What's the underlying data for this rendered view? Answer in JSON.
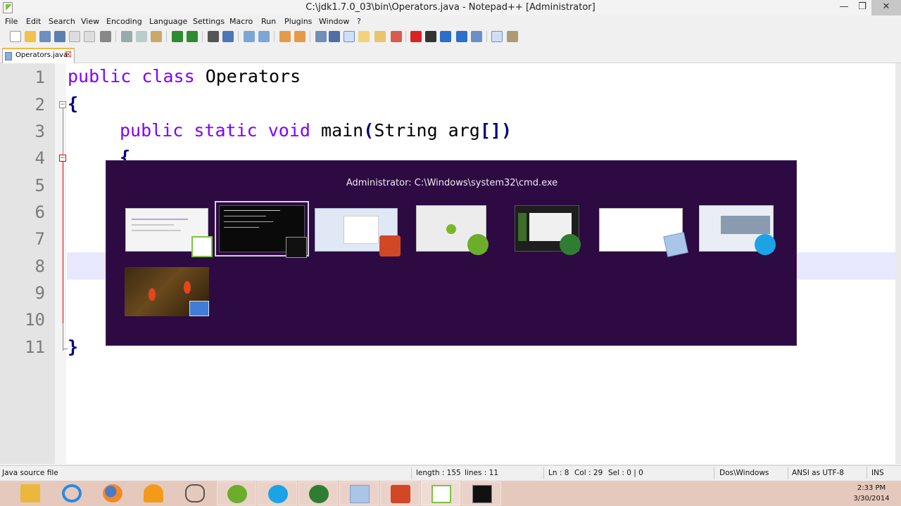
{
  "window": {
    "title": "C:\\jdk1.7.0_03\\bin\\Operators.java - Notepad++ [Administrator]",
    "minimize_glyph": "—",
    "restore_glyph": "❐",
    "close_glyph": "✕"
  },
  "menu": {
    "items": [
      "File",
      "Edit",
      "Search",
      "View",
      "Encoding",
      "Language",
      "Settings",
      "Macro",
      "Run",
      "Plugins",
      "Window",
      "?"
    ]
  },
  "tabs": [
    {
      "label": "Operators.java",
      "close_glyph": "☒"
    }
  ],
  "editor": {
    "line_numbers": [
      "1",
      "2",
      "3",
      "4",
      "5",
      "6",
      "7",
      "8",
      "9",
      "10",
      "11"
    ],
    "lines": {
      "l1_kw1": "public",
      "l1_kw2": "class",
      "l1_name": "Operators",
      "l2_brace": "{",
      "l3_kw1": "public",
      "l3_kw2": "static",
      "l3_kw3": "void",
      "l3_method": "main",
      "l3_open": "(",
      "l3_args": "String arg",
      "l3_brackets": "[]",
      "l3_close": ")",
      "l4_brace": "{",
      "l11_brace": "}"
    },
    "current_line": 8,
    "fold_markers": [
      "−",
      "−"
    ]
  },
  "task_switcher": {
    "title": "Administrator: C:\\Windows\\system32\\cmd.exe",
    "selected_index": 1,
    "windows": [
      {
        "icon": "notepadpp-icon"
      },
      {
        "icon": "cmd-icon"
      },
      {
        "icon": "powerpoint-icon"
      },
      {
        "icon": "utorrent-icon"
      },
      {
        "icon": "ccleaner-icon"
      },
      {
        "icon": "notepad-icon"
      },
      {
        "icon": "skype-icon"
      },
      {
        "icon": "photo-viewer-icon"
      }
    ]
  },
  "status": {
    "file_type": "Java source file",
    "length": "length : 155",
    "lines": "lines : 11",
    "ln": "Ln : 8",
    "col": "Col : 29",
    "sel": "Sel : 0 | 0",
    "eol": "Dos\\Windows",
    "encoding": "ANSI as UTF-8",
    "mode": "INS"
  },
  "taskbar": {
    "apps": [
      "file-explorer-icon",
      "internet-explorer-icon",
      "firefox-icon",
      "avast-icon",
      "sony-vaio-icon",
      "utorrent-icon",
      "skype-icon",
      "ccleaner-icon",
      "notepad-icon",
      "powerpoint-icon",
      "notepadpp-icon",
      "cmd-icon"
    ],
    "clock_time": "2:33 PM",
    "clock_date": "3/30/2014"
  },
  "colors": {
    "keyword": "#8000ff",
    "brace": "#000080",
    "switcher_bg": "#2d0a42",
    "taskbar_bg": "#e6c9bd",
    "current_line": "#e8e8ff",
    "tab_accent": "#fab53c"
  }
}
